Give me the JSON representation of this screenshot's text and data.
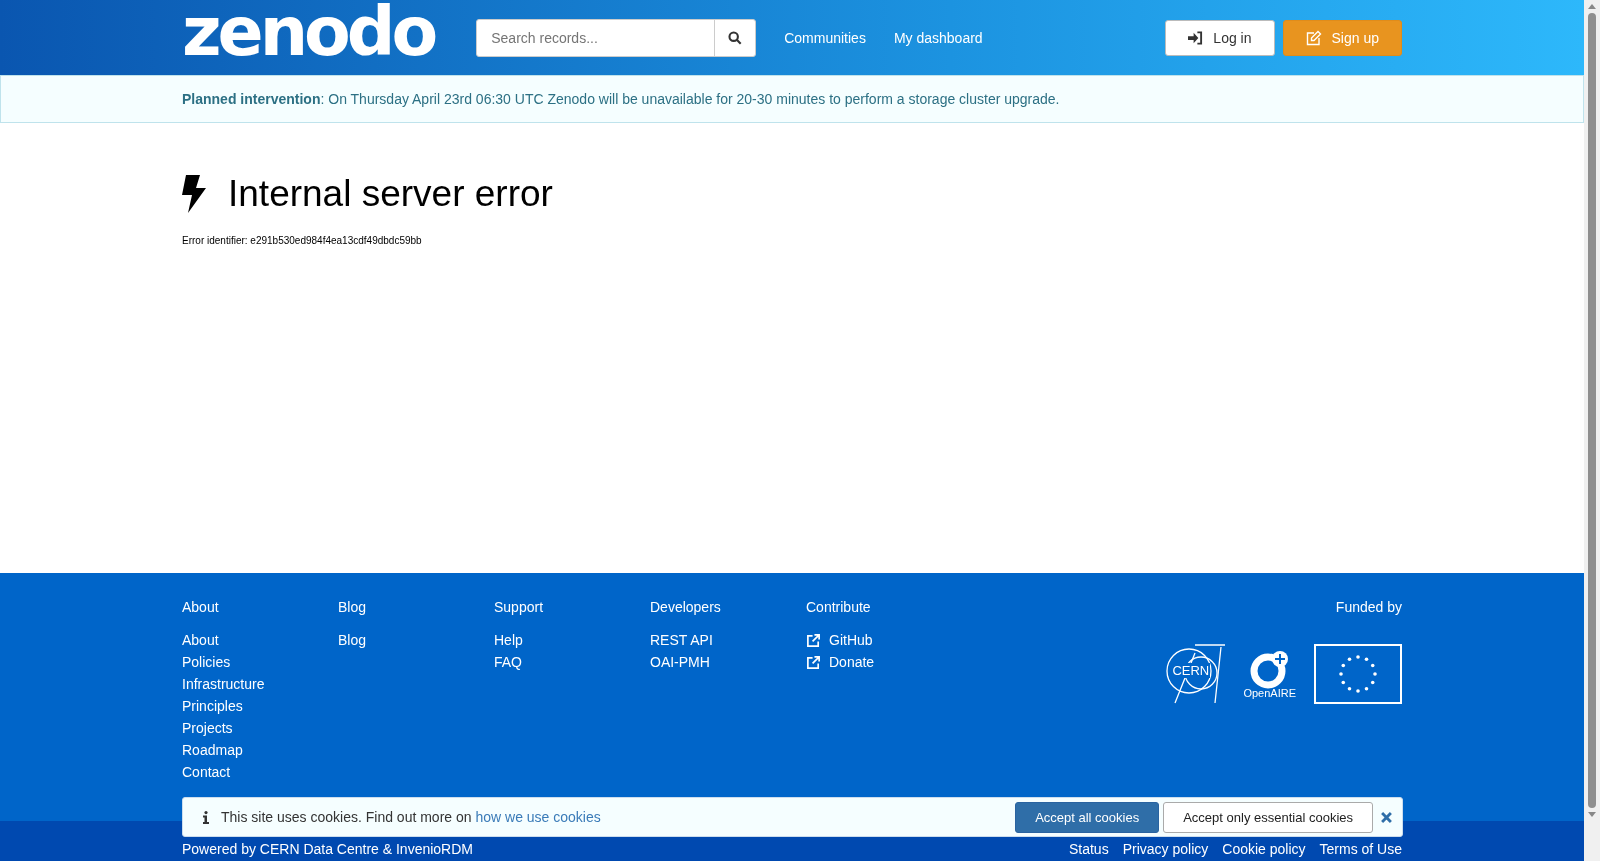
{
  "header": {
    "logo": "zenodo",
    "search": {
      "placeholder": "Search records..."
    },
    "nav": [
      "Communities",
      "My dashboard"
    ],
    "buttons": [
      {
        "kind": "login",
        "label": "Log in"
      },
      {
        "kind": "signup",
        "label": "Sign up"
      }
    ]
  },
  "notice": {
    "title": "Planned intervention",
    "text": ": On Thursday April 23rd 06:30 UTC Zenodo will be unavailable for 20-30 minutes to perform a storage cluster upgrade."
  },
  "error": {
    "title": "Internal server error",
    "identifier": "Error identifier: e291b530ed984f4ea13cdf49dbdc59bb"
  },
  "footer": {
    "columns": [
      {
        "heading": "About",
        "links": [
          {
            "label": "About",
            "external": false
          },
          {
            "label": "Policies",
            "external": false
          },
          {
            "label": "Infrastructure",
            "external": false
          },
          {
            "label": "Principles",
            "external": false
          },
          {
            "label": "Projects",
            "external": false
          },
          {
            "label": "Roadmap",
            "external": false
          },
          {
            "label": "Contact",
            "external": false
          }
        ]
      },
      {
        "heading": "Blog",
        "links": [
          {
            "label": "Blog",
            "external": false
          }
        ]
      },
      {
        "heading": "Support",
        "links": [
          {
            "label": "Help",
            "external": false
          },
          {
            "label": "FAQ",
            "external": false
          }
        ]
      },
      {
        "heading": "Developers",
        "links": [
          {
            "label": "REST API",
            "external": false
          },
          {
            "label": "OAI-PMH",
            "external": false
          }
        ]
      },
      {
        "heading": "Contribute",
        "links": [
          {
            "label": "GitHub",
            "external": true
          },
          {
            "label": "Donate",
            "external": true
          }
        ]
      }
    ],
    "funded_by": "Funded by",
    "funders": [
      {
        "kind": "cern",
        "label": "CERN"
      },
      {
        "kind": "openaire",
        "label": "OpenAIRE"
      },
      {
        "kind": "eu"
      }
    ]
  },
  "bottom_bar": {
    "powered": "Powered by CERN Data Centre & InvenioRDM",
    "links": [
      "Status",
      "Privacy policy",
      "Cookie policy",
      "Terms of Use"
    ]
  },
  "cookie_banner": {
    "text": "This site uses cookies. Find out more on ",
    "link": "how we use cookies",
    "accept_all": "Accept all cookies",
    "accept_essential": "Accept only essential cookies"
  }
}
